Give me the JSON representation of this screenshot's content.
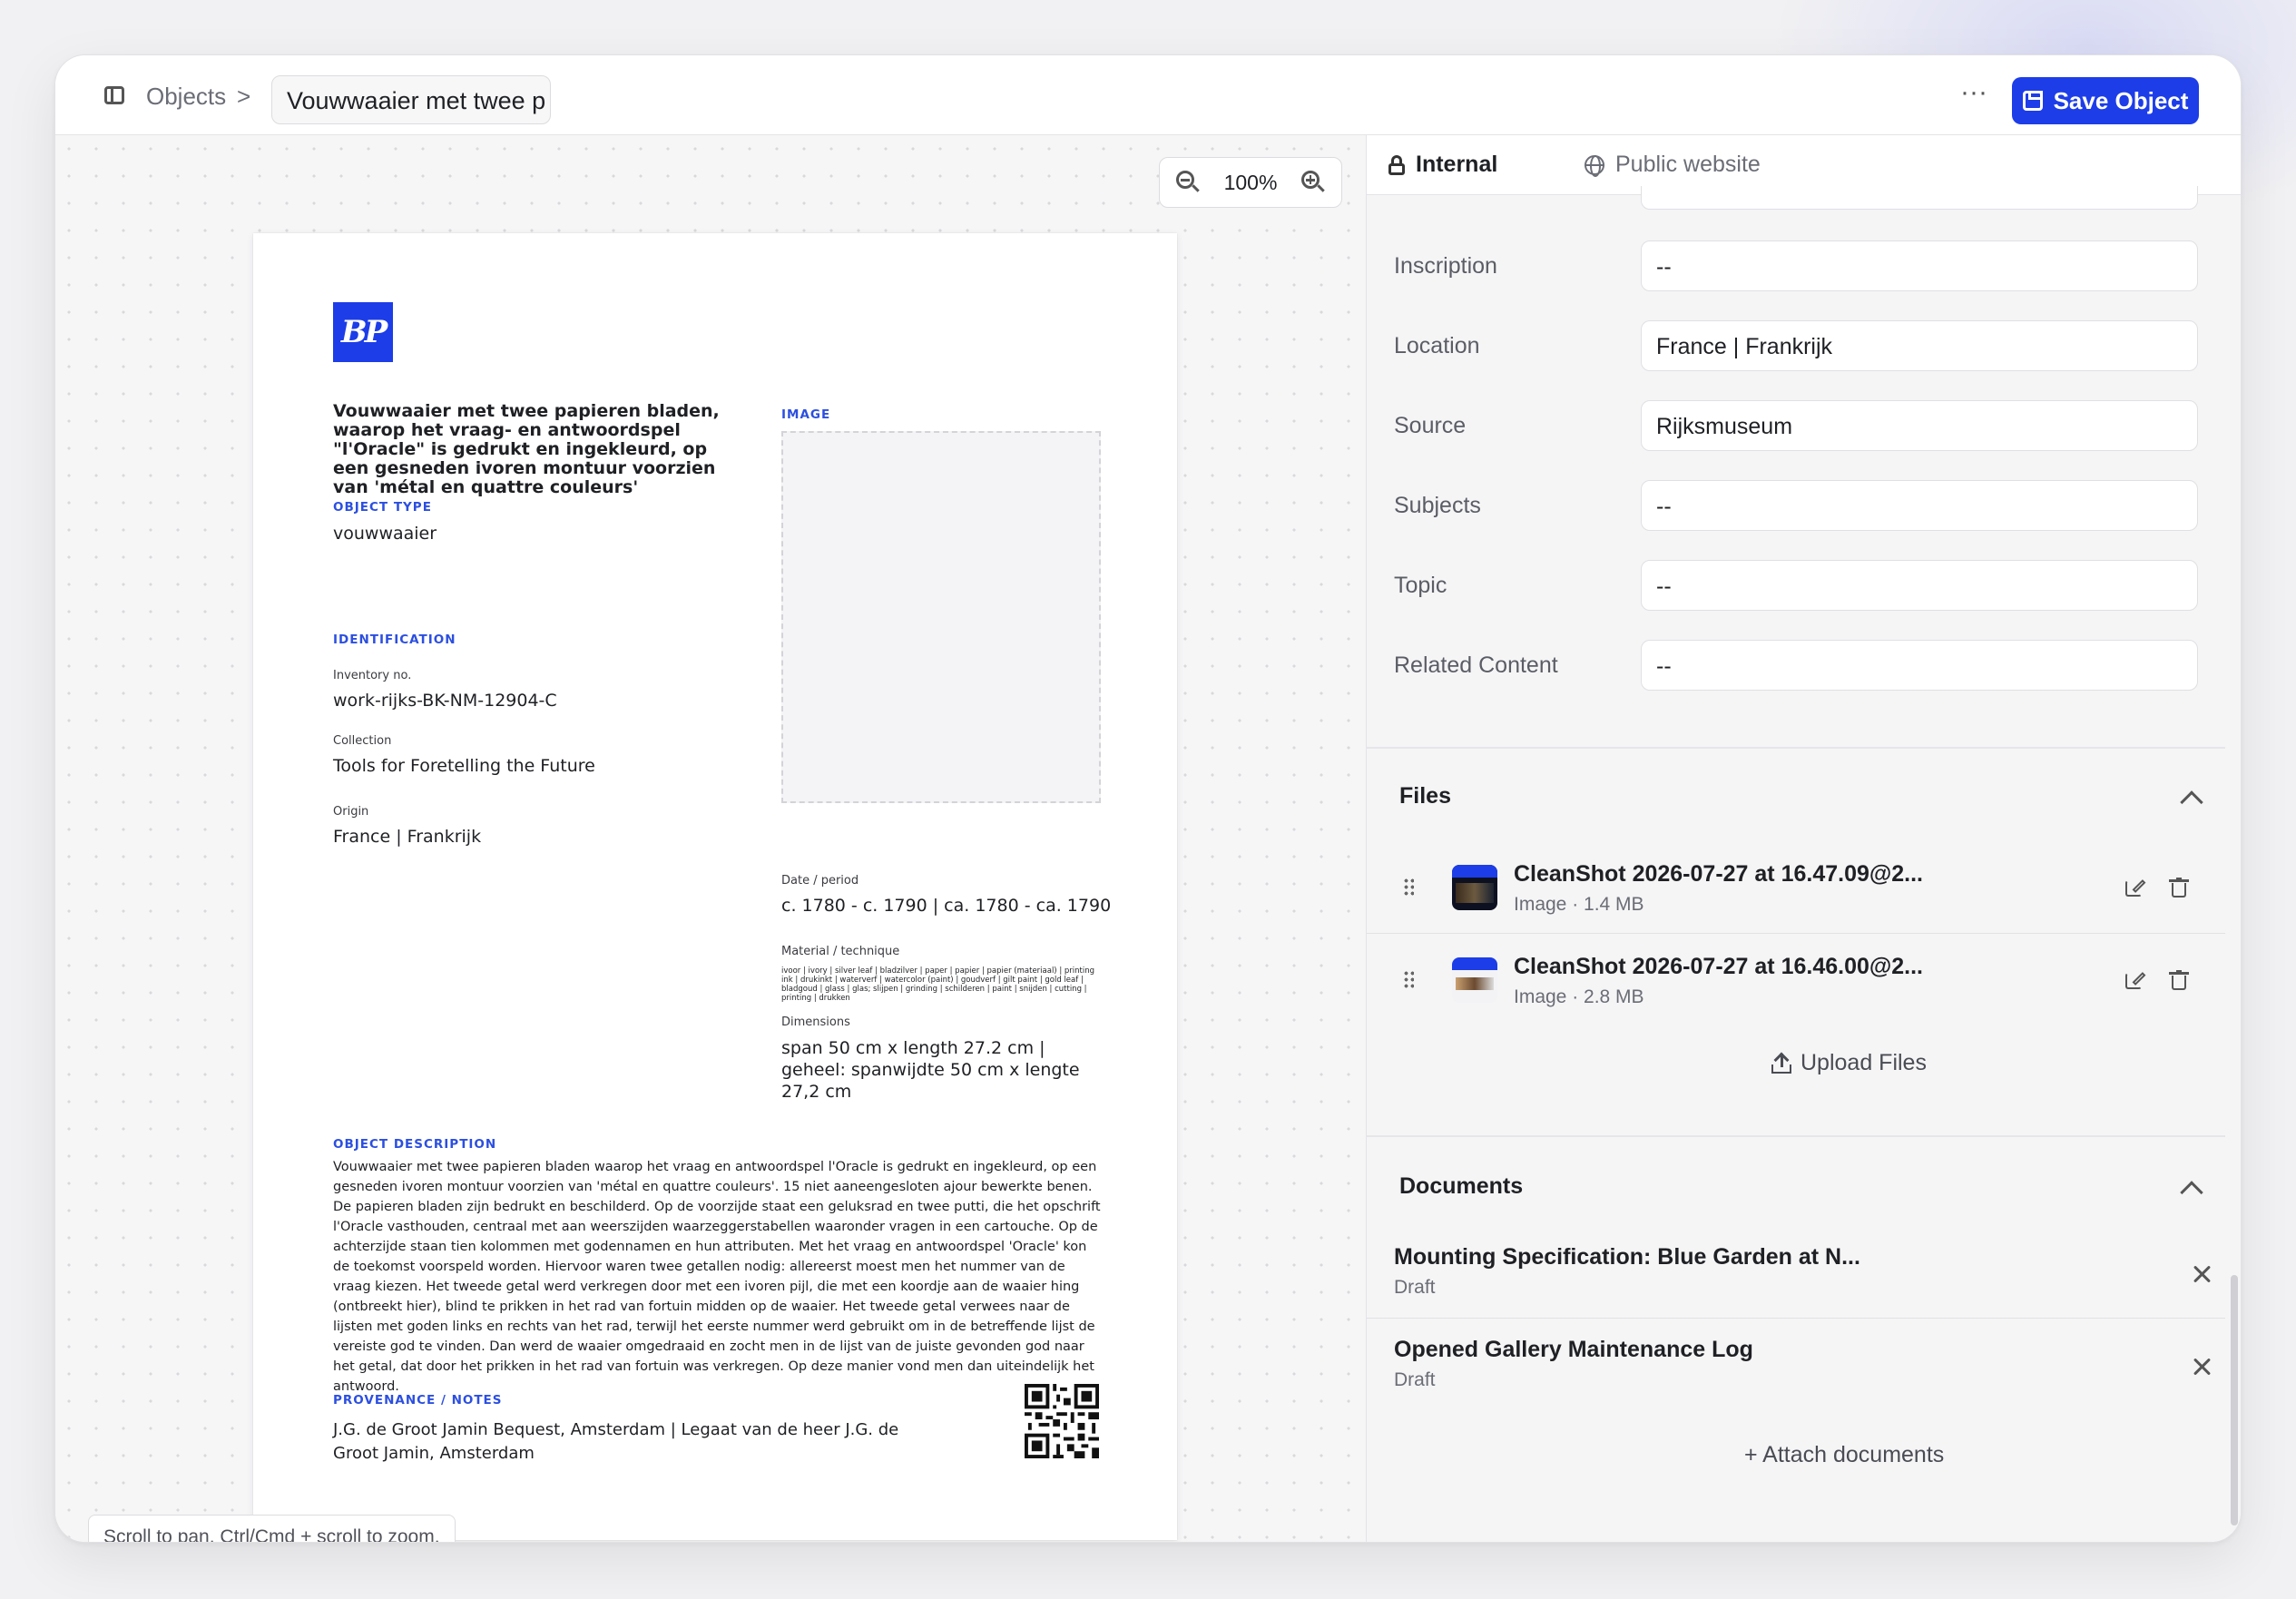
{
  "breadcrumb": {
    "root": "Objects",
    "separator": ">",
    "current": "Vouwwaaier met twee p"
  },
  "toolbar": {
    "more": "···",
    "save_label": "Save Object"
  },
  "canvas": {
    "zoom_level": "100%",
    "hint": "Scroll to pan. Ctrl/Cmd + scroll to zoom."
  },
  "document": {
    "logo_text": "BP",
    "title": "Vouwwaaier met twee papieren bladen, waarop het vraag- en antwoordspel \"l'Oracle\" is gedrukt en ingekleurd, op een gesneden ivoren montuur voorzien van 'métal en quattre couleurs'",
    "image_label": "IMAGE",
    "object_type_label": "OBJECT TYPE",
    "object_type": "vouwwaaier",
    "identification_label": "IDENTIFICATION",
    "inventory_label": "Inventory no.",
    "inventory": "work-rijks-BK-NM-12904-C",
    "collection_label": "Collection",
    "collection": "Tools for Foretelling the Future",
    "origin_label": "Origin",
    "origin": "France | Frankrijk",
    "date_label": "Date / period",
    "date": "c. 1780 - c. 1790 | ca. 1780 - ca. 1790",
    "material_label": "Material / technique",
    "material": "ivoor | ivory | silver leaf | bladzilver | paper | papier | papier (materiaal) | printing ink | drukinkt | waterverf | watercolor (paint) | goudverf | gilt paint | gold leaf | bladgoud | glass | glas; slijpen | grinding | schilderen | paint | snijden | cutting | printing | drukken",
    "dimensions_label": "Dimensions",
    "dimensions": "span 50 cm x length 27.2 cm | geheel: spanwijdte 50 cm x lengte 27,2 cm",
    "description_label": "OBJECT DESCRIPTION",
    "description": "Vouwwaaier met twee papieren bladen waarop het vraag en antwoordspel l'Oracle is gedrukt en ingekleurd, op een gesneden ivoren montuur voorzien van 'métal en quattre couleurs'. 15 niet aaneengesloten ajour bewerkte benen. De papieren bladen zijn bedrukt en beschilderd. Op de voorzijde staat een geluksrad en twee putti, die het opschrift l'Oracle vasthouden, centraal met aan weerszijden waarzeggerstabellen waaronder vragen in een cartouche. Op de achterzijde staan tien kolommen met godennamen en hun attributen. Met het vraag en antwoordspel 'Oracle' kon de toekomst voorspeld worden. Hiervoor waren twee getallen nodig: allereerst moest men het nummer van de vraag kiezen. Het tweede getal werd verkregen door met een ivoren pijl, die met een koordje aan de waaier hing (ontbreekt hier), blind te prikken in het rad van fortuin midden op de waaier. Het tweede getal verwees naar de lijsten met goden links en rechts van het rad, terwijl het eerste nummer werd gebruikt om in de betreffende lijst de vereiste god te vinden. Dan werd de waaier omgedraaid en zocht men in de lijst van de juiste gevonden god naar het getal, dat door het prikken in het rad van fortuin was verkregen. Op deze manier vond men dan uiteindelijk het antwoord.",
    "provenance_label": "PROVENANCE / NOTES",
    "provenance": "J.G. de Groot Jamin Bequest, Amsterdam | Legaat van de heer J.G. de Groot Jamin, Amsterdam"
  },
  "panel": {
    "tabs": [
      {
        "label": "Internal",
        "icon": "lock-icon",
        "active": true
      },
      {
        "label": "Public website",
        "icon": "globe-icon",
        "active": false
      }
    ],
    "fields": [
      {
        "label": "Inscription",
        "value": "--"
      },
      {
        "label": "Location",
        "value": "France | Frankrijk"
      },
      {
        "label": "Source",
        "value": "Rijksmuseum"
      },
      {
        "label": "Subjects",
        "value": "--"
      },
      {
        "label": "Topic",
        "value": "--"
      },
      {
        "label": "Related Content",
        "value": "--"
      }
    ],
    "files": {
      "title": "Files",
      "items": [
        {
          "name": "CleanShot 2026-07-27 at 16.47.09@2...",
          "meta": "Image · 1.4 MB"
        },
        {
          "name": "CleanShot 2026-07-27 at 16.46.00@2...",
          "meta": "Image · 2.8 MB"
        }
      ],
      "upload_label": "Upload Files"
    },
    "documents": {
      "title": "Documents",
      "items": [
        {
          "name": "Mounting Specification: Blue Garden at N...",
          "status": "Draft"
        },
        {
          "name": "Opened Gallery Maintenance Log",
          "status": "Draft"
        }
      ],
      "attach_label": "+ Attach documents"
    }
  },
  "colors": {
    "accent": "#1d3de8",
    "label_blue": "#2c4fe0"
  }
}
